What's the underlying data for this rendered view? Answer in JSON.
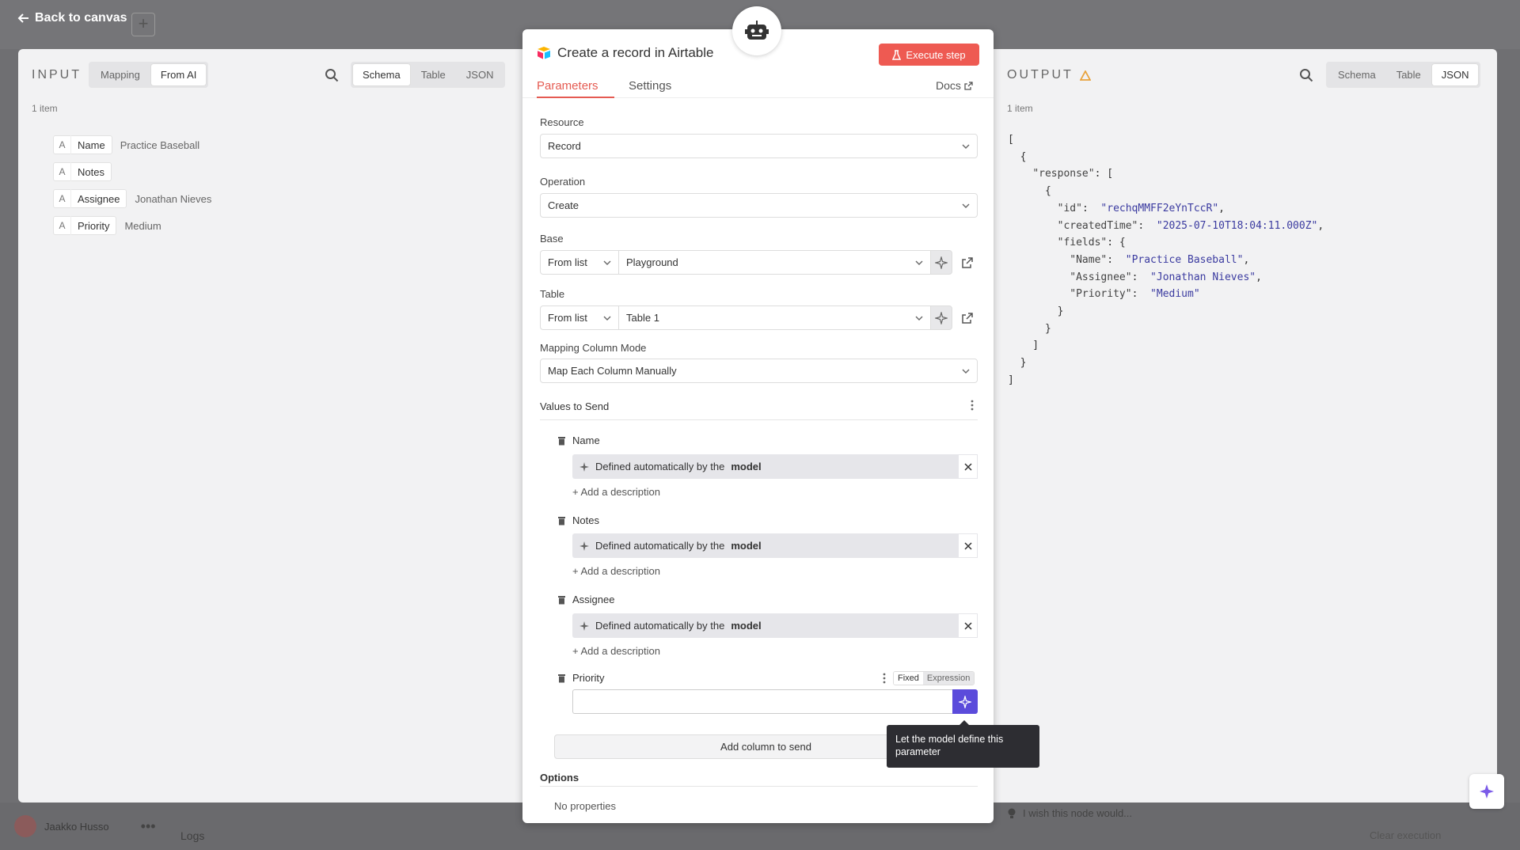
{
  "header": {
    "back_label": "Back to canvas"
  },
  "bottom": {
    "user_name": "Jaakko Husso",
    "logs_label": "Logs",
    "clear_execution": "Clear execution",
    "wish_text": "I wish this node would..."
  },
  "input": {
    "label": "INPUT",
    "mode_tabs": [
      "Mapping",
      "From AI"
    ],
    "active_mode": "From AI",
    "view_tabs": [
      "Schema",
      "Table",
      "JSON"
    ],
    "active_view": "Schema",
    "item_count": "1 item",
    "rows": [
      {
        "type": "A",
        "key": "Name",
        "value": "Practice Baseball"
      },
      {
        "type": "A",
        "key": "Notes",
        "value": ""
      },
      {
        "type": "A",
        "key": "Assignee",
        "value": "Jonathan Nieves"
      },
      {
        "type": "A",
        "key": "Priority",
        "value": "Medium"
      }
    ]
  },
  "output": {
    "label": "OUTPUT",
    "view_tabs": [
      "Schema",
      "Table",
      "JSON"
    ],
    "active_view": "JSON",
    "item_count": "1 item",
    "json": {
      "id": "rechqMMFF2eYnTccR",
      "createdTime": "2025-07-10T18:04:11.000Z",
      "fields": {
        "Name": "Practice Baseball",
        "Assignee": "Jonathan Nieves",
        "Priority": "Medium"
      }
    }
  },
  "node": {
    "title": "Create a record in Airtable",
    "execute_label": "Execute step",
    "tabs": [
      "Parameters",
      "Settings"
    ],
    "active_tab": "Parameters",
    "docs_label": "Docs",
    "resource_label": "Resource",
    "resource_value": "Record",
    "operation_label": "Operation",
    "operation_value": "Create",
    "base_label": "Base",
    "base_mode": "From list",
    "base_value": "Playground",
    "table_label": "Table",
    "table_mode": "From list",
    "table_value": "Table 1",
    "mapping_label": "Mapping Column Mode",
    "mapping_value": "Map Each Column Manually",
    "values_title": "Values to Send",
    "auto_prefix": "Defined automatically by the",
    "auto_bold": "model",
    "add_description": "+ Add a description",
    "fields": [
      "Name",
      "Notes",
      "Assignee"
    ],
    "priority_label": "Priority",
    "fixed_label": "Fixed",
    "expression_label": "Expression",
    "add_column": "Add column to send",
    "options_title": "Options",
    "no_properties": "No properties",
    "tooltip": "Let the model define this parameter"
  },
  "colors": {
    "accent": "#ee5a52",
    "ai": "#5b4bdb"
  }
}
